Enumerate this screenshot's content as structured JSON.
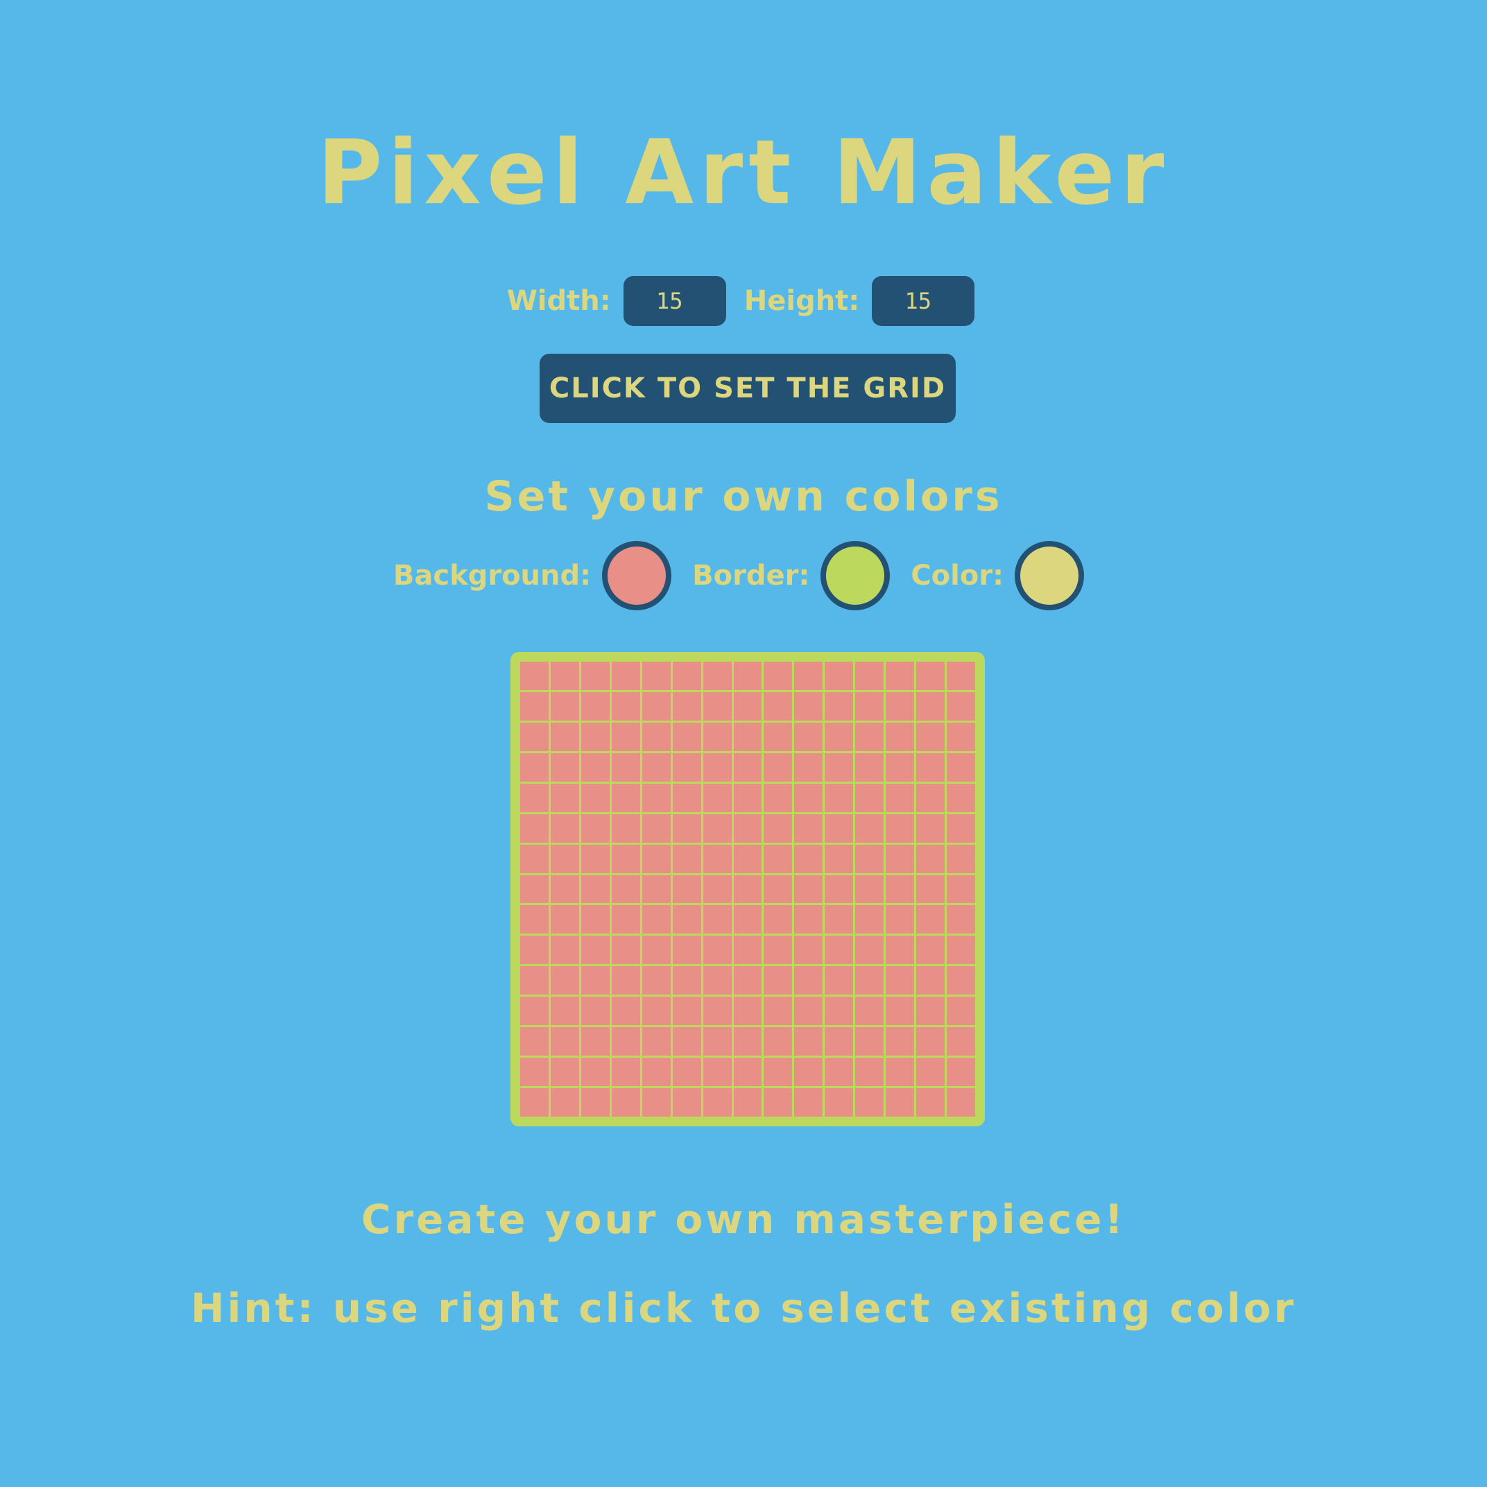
{
  "app": {
    "title": "Pixel Art Maker"
  },
  "size_controls": {
    "width_label": "Width:",
    "width_value": "15",
    "height_label": "Height:",
    "height_value": "15",
    "set_grid_button": "CLICK TO SET THE GRID"
  },
  "colors": {
    "heading": "Set your own colors",
    "background_label": "Background:",
    "background_color": "#e88f87",
    "border_label": "Border:",
    "border_color": "#bcd95e",
    "color_label": "Color:",
    "paint_color": "#dcd67e"
  },
  "canvas": {
    "columns": 15,
    "rows": 15
  },
  "footer": {
    "tagline": "Create your own masterpiece!",
    "hint": "Hint: use right click to select existing color"
  }
}
